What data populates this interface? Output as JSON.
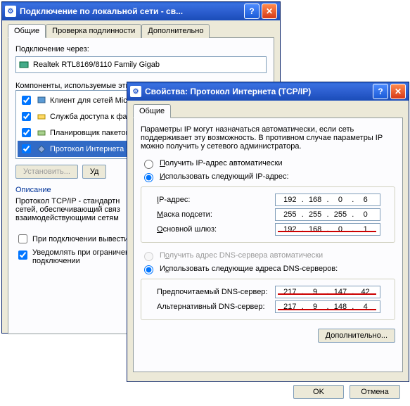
{
  "win1": {
    "title": "Подключение по локальной сети - св...",
    "tabs": [
      "Общие",
      "Проверка подлинности",
      "Дополнительно"
    ],
    "connect_via": "Подключение через:",
    "adapter": "Realtek RTL8169/8110 Family Gigab",
    "components_label": "Компоненты, используемые этим",
    "items": [
      "Клиент для сетей Micr",
      "Служба доступа к фай",
      "Планировщик пакетов",
      "Протокол Интернета (T"
    ],
    "install": "Установить...",
    "uninstall": "Уд",
    "desc_title": "Описание",
    "desc_text": "Протокол TCP/IP - стандартн\nсетей, обеспечивающий связ\nвзаимодействующими сетям",
    "chk1": "При подключении вывести з",
    "chk2": "Уведомлять при ограниченн\nподключении"
  },
  "win2": {
    "title": "Свойства: Протокол Интернета (TCP/IP)",
    "tab": "Общие",
    "intro": "Параметры IP могут назначаться автоматически, если сеть поддерживает эту возможность. В противном случае параметры IP можно получить у сетевого администратора.",
    "r1": "Получить IP-адрес автоматически",
    "r2": "Использовать следующий IP-адрес:",
    "ip_lbl": "IP-адрес:",
    "mask_lbl": "Маска подсети:",
    "gw_lbl": "Основной шлюз:",
    "ip": [
      "192",
      "168",
      "0",
      "6"
    ],
    "mask": [
      "255",
      "255",
      "255",
      "0"
    ],
    "gw": [
      "192",
      "168",
      "0",
      "1"
    ],
    "r3": "Получить адрес DNS-сервера автоматически",
    "r4": "Использовать следующие адреса DNS-серверов:",
    "dns1_lbl": "Предпочитаемый DNS-сервер:",
    "dns2_lbl": "Альтернативный DNS-сервер:",
    "dns1": [
      "217",
      "9",
      "147",
      "42"
    ],
    "dns2": [
      "217",
      "9",
      "148",
      "4"
    ],
    "advanced": "Дополнительно...",
    "ok": "OK",
    "cancel": "Отмена"
  }
}
